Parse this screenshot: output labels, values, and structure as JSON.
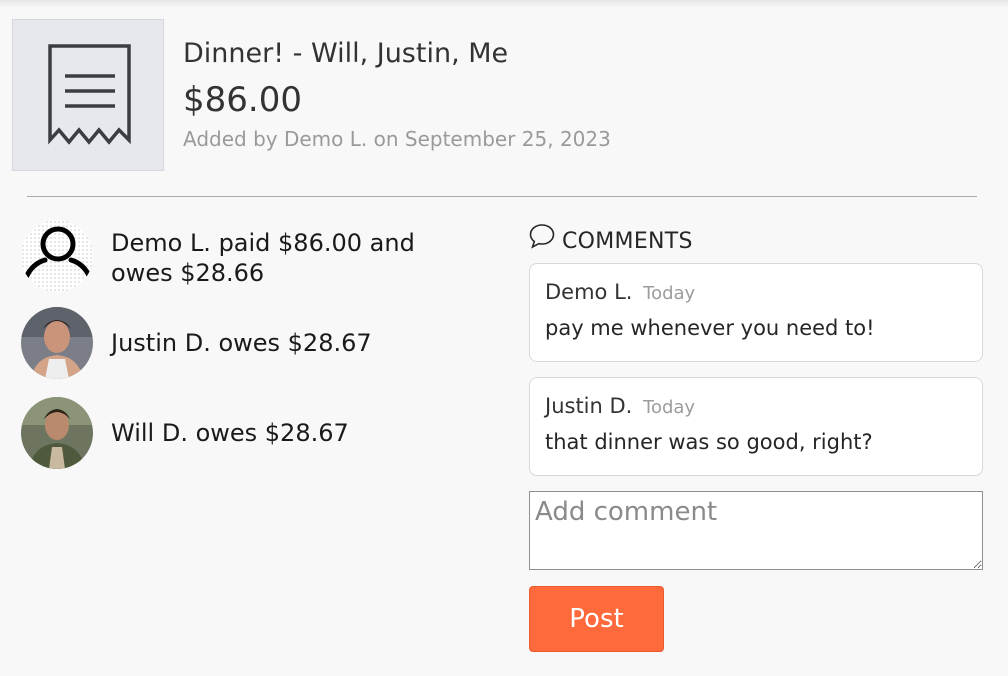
{
  "expense": {
    "title": "Dinner! - Will, Justin, Me",
    "amount": "$86.00",
    "added_by": "Added by Demo L. on September 25, 2023",
    "icon": "receipt-icon"
  },
  "participants": [
    {
      "text": "Demo L. paid $86.00 and owes $28.66",
      "avatar": "default-user-icon"
    },
    {
      "text": "Justin D. owes $28.67",
      "avatar": "user-photo"
    },
    {
      "text": "Will D. owes $28.67",
      "avatar": "user-photo"
    }
  ],
  "comments_section": {
    "header": "COMMENTS",
    "icon": "speech-bubble-icon",
    "comments": [
      {
        "author": "Demo L.",
        "time": "Today",
        "body": "pay me whenever you need to!"
      },
      {
        "author": "Justin D.",
        "time": "Today",
        "body": "that dinner was so good, right?"
      }
    ],
    "input_placeholder": "Add comment",
    "post_label": "Post"
  },
  "colors": {
    "accent": "#ff6a3d",
    "background": "#f8f8f8",
    "muted_text": "#9a9a9a"
  }
}
